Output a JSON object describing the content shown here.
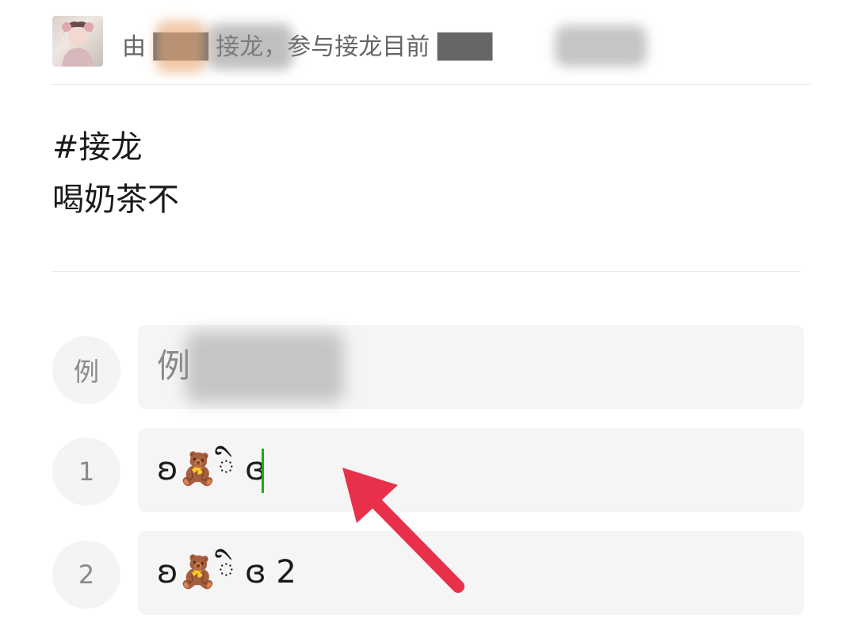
{
  "header": {
    "avatar_icon": "user-avatar",
    "text_visible": "由 ███ 接龙，参与接龙目前 ███"
  },
  "post": {
    "topic": "#接龙",
    "body": "喝奶茶不"
  },
  "rows": [
    {
      "num": "例",
      "value": "例"
    },
    {
      "num": "1",
      "value": "ʚ🧸ི ɞ"
    },
    {
      "num": "2",
      "value": "ʚ🧸ི ɞ 2"
    }
  ],
  "colors": {
    "cursor": "#1aad19",
    "arrow": "#e8304a",
    "input_bg": "#f5f5f5"
  }
}
